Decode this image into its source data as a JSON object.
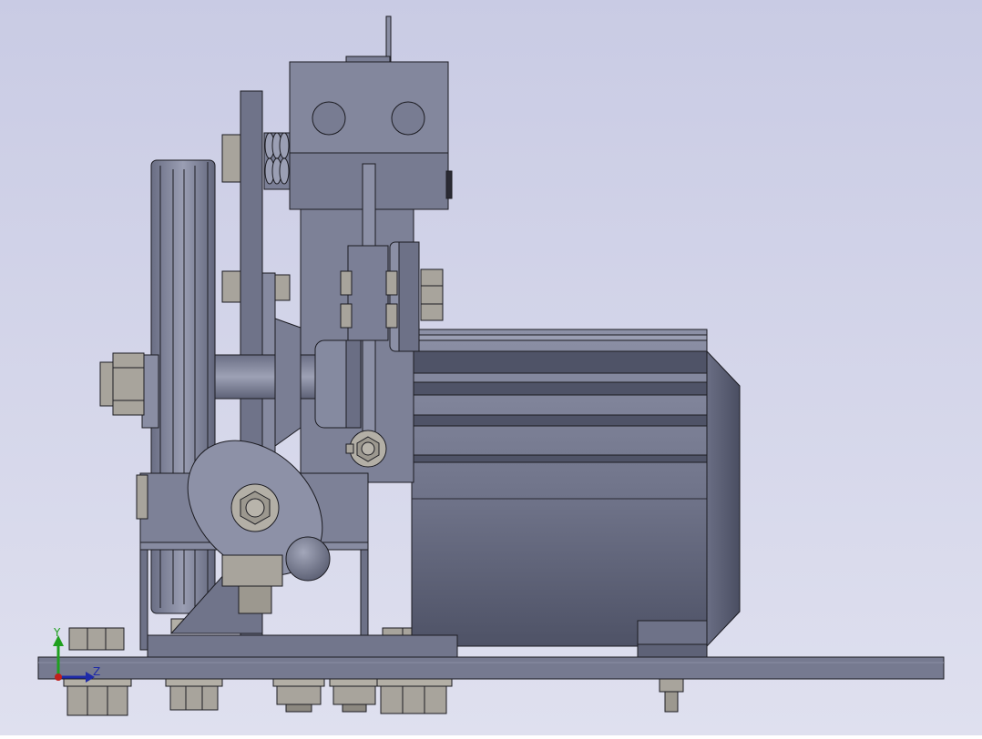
{
  "view": {
    "background_top": "#c9cbe4",
    "background_bottom": "#dfe0ef",
    "part_color": "#7b7f96",
    "part_dark": "#565a70",
    "part_light": "#9a9eb3",
    "hardware_color": "#a8a49c",
    "edge_color": "#1c1c22"
  },
  "triad": {
    "y_label": "Y",
    "z_label": "Z",
    "y_color": "#1fa01f",
    "z_color": "#1e2aa8",
    "origin_color": "#c0201c"
  },
  "parts": {
    "motor": "motor-body",
    "pulley": "v-belt-pulley",
    "base": "base-plate",
    "tensioner": "tensioner-cam"
  }
}
